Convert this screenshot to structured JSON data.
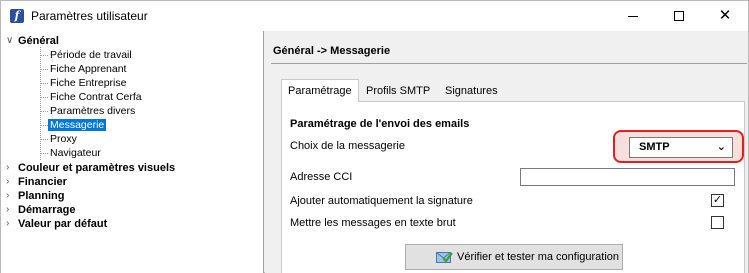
{
  "window": {
    "title": "Paramètres utilisateur",
    "close_glyph": "✕"
  },
  "tree": {
    "top_items": [
      {
        "label": "Général",
        "caret": "∨"
      },
      {
        "label": "Couleur et paramètres visuels",
        "caret": "›"
      },
      {
        "label": "Financier",
        "caret": "›"
      },
      {
        "label": "Planning",
        "caret": "›"
      },
      {
        "label": "Démarrage",
        "caret": "›"
      },
      {
        "label": "Valeur par défaut",
        "caret": "›"
      }
    ],
    "general_children": [
      "Période de travail",
      "Fiche Apprenant",
      "Fiche Entreprise",
      "Fiche Contrat Cerfa",
      "Paramètres divers",
      "Messagerie",
      "Proxy",
      "Navigateur"
    ],
    "selected": "Messagerie"
  },
  "panel": {
    "header": "Général -> Messagerie",
    "tabs": [
      "Paramétrage",
      "Profils SMTP",
      "Signatures"
    ],
    "active_tab": "Paramétrage",
    "section_title": "Paramétrage de l'envoi des emails",
    "mail_choice": {
      "label": "Choix de la messagerie",
      "value": "SMTP",
      "chevron": "⌄"
    },
    "cci": {
      "label": "Adresse CCI",
      "value": ""
    },
    "auto_signature": {
      "label": "Ajouter automatiquement la signature",
      "checked": true,
      "mark": "✓"
    },
    "plain_text": {
      "label": "Mettre les messages en texte brut",
      "checked": false
    },
    "verify_button": "Vérifier et tester ma configuration"
  },
  "colors": {
    "selection": "#0078d7",
    "highlight_ring": "#e02020",
    "highlight_fill": "#f9dede",
    "app_icon": "#2b4f9e"
  }
}
